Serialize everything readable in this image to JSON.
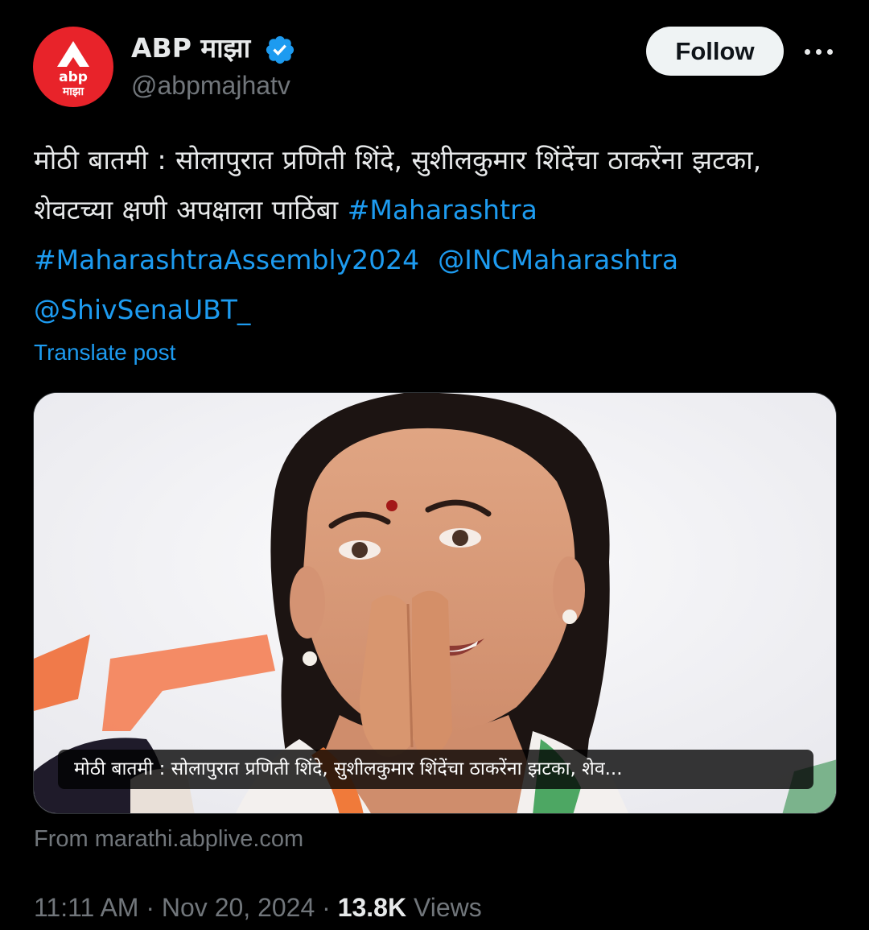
{
  "author": {
    "avatar_text_top": "abp",
    "avatar_text_bottom": "माझा",
    "display_name": "ABP माझा",
    "handle": "@abpmajhatv",
    "verified_icon": "verified-badge-icon"
  },
  "actions": {
    "follow_label": "Follow",
    "more_icon": "more-options-icon"
  },
  "tweet": {
    "text_main": "मोठी बातमी : सोलापुरात प्रणिती शिंदे, सुशीलकुमार शिंदेंचा ठाकरेंना झटका, शेवटच्या क्षणी अपक्षाला पाठिंबा",
    "hashtag_1": "#Maharashtra",
    "hashtag_2": "#MaharashtraAssembly2024",
    "mention_1": "@INCMaharashtra",
    "mention_2": "@ShivSenaUBT_",
    "translate_label": "Translate post"
  },
  "card": {
    "caption": "मोठी बातमी : सोलापुरात प्रणिती शिंदे, सुशीलकुमार शिंदेंचा ठाकरेंना झटका, शेव...",
    "source": "From marathi.abplive.com"
  },
  "meta": {
    "time": "11:11 AM",
    "separator": "·",
    "date": "Nov 20, 2024",
    "views_count": "13.8K",
    "views_label": "Views"
  },
  "colors": {
    "background": "#000000",
    "text_primary": "#e7e9ea",
    "text_secondary": "#71767b",
    "link": "#1d9bf0",
    "avatar_red": "#e8232a",
    "follow_bg": "#eff3f4"
  }
}
